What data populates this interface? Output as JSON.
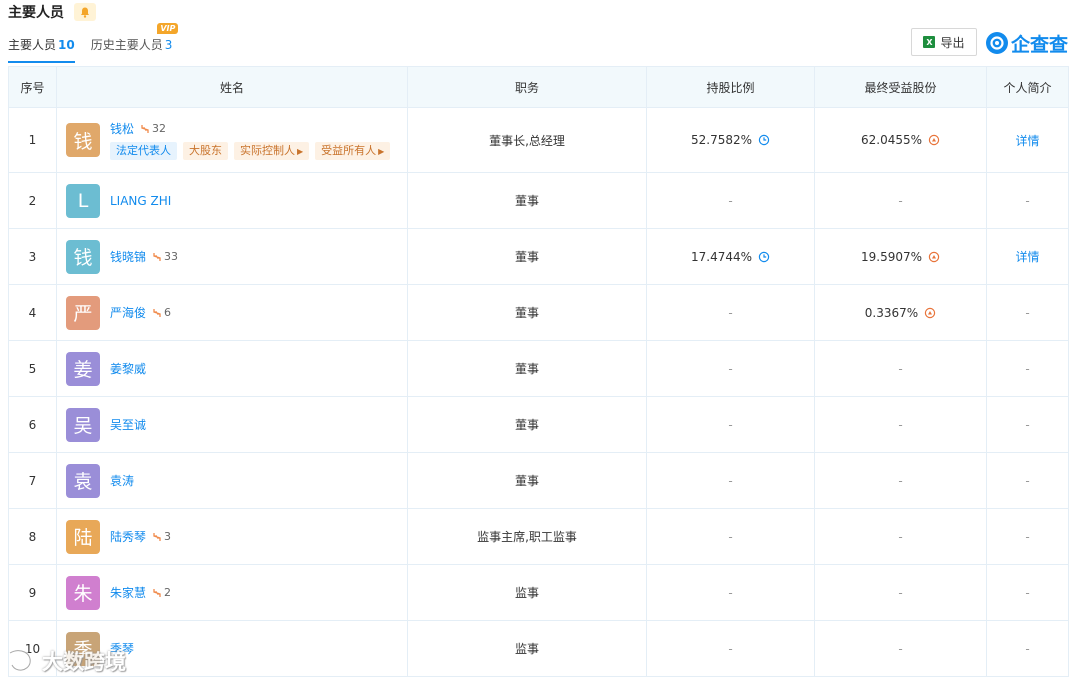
{
  "header": {
    "title": "主要人员"
  },
  "tabs": [
    {
      "label": "主要人员",
      "count": "10"
    },
    {
      "label": "历史主要人员",
      "count": "3",
      "badge": "VIP"
    }
  ],
  "toolbar": {
    "export_label": "导出",
    "excel_glyph": "X",
    "brand": "企查查"
  },
  "columns": [
    "序号",
    "姓名",
    "职务",
    "持股比例",
    "最终受益股份",
    "个人简介"
  ],
  "rows": [
    {
      "no": "1",
      "avatar": "钱",
      "avatar_color": "#e0a86a",
      "name": "钱松",
      "rel": "32",
      "tags": [
        {
          "text": "法定代表人",
          "style": "blue",
          "arrow": false
        },
        {
          "text": "大股东",
          "style": "orange",
          "arrow": false
        },
        {
          "text": "实际控制人",
          "style": "orange",
          "arrow": true
        },
        {
          "text": "受益所有人",
          "style": "orange",
          "arrow": true
        }
      ],
      "position": "董事长,总经理",
      "share": "52.7582%",
      "final": "62.0455%",
      "intro": "详情"
    },
    {
      "no": "2",
      "avatar": "L",
      "avatar_color": "#6cbdd2",
      "name": "LIANG ZHI",
      "rel": "",
      "tags": [],
      "position": "董事",
      "share": "-",
      "final": "-",
      "intro": "-"
    },
    {
      "no": "3",
      "avatar": "钱",
      "avatar_color": "#6cbdd2",
      "name": "钱晓锦",
      "rel": "33",
      "tags": [],
      "position": "董事",
      "share": "17.4744%",
      "final": "19.5907%",
      "intro": "详情"
    },
    {
      "no": "4",
      "avatar": "严",
      "avatar_color": "#e39b7c",
      "name": "严海俊",
      "rel": "6",
      "tags": [],
      "position": "董事",
      "share": "-",
      "final": "0.3367%",
      "intro": "-"
    },
    {
      "no": "5",
      "avatar": "姜",
      "avatar_color": "#9a8ed8",
      "name": "姜黎威",
      "rel": "",
      "tags": [],
      "position": "董事",
      "share": "-",
      "final": "-",
      "intro": "-"
    },
    {
      "no": "6",
      "avatar": "吴",
      "avatar_color": "#9a8ed8",
      "name": "吴至诚",
      "rel": "",
      "tags": [],
      "position": "董事",
      "share": "-",
      "final": "-",
      "intro": "-"
    },
    {
      "no": "7",
      "avatar": "袁",
      "avatar_color": "#9a8ed8",
      "name": "袁涛",
      "rel": "",
      "tags": [],
      "position": "董事",
      "share": "-",
      "final": "-",
      "intro": "-"
    },
    {
      "no": "8",
      "avatar": "陆",
      "avatar_color": "#e8a858",
      "name": "陆秀琴",
      "rel": "3",
      "tags": [],
      "position": "监事主席,职工监事",
      "share": "-",
      "final": "-",
      "intro": "-"
    },
    {
      "no": "9",
      "avatar": "朱",
      "avatar_color": "#d07fcf",
      "name": "朱家慧",
      "rel": "2",
      "tags": [],
      "position": "监事",
      "share": "-",
      "final": "-",
      "intro": "-"
    },
    {
      "no": "10",
      "avatar": "季",
      "avatar_color": "#c8a477",
      "name": "季琴",
      "rel": "",
      "tags": [],
      "position": "监事",
      "share": "-",
      "final": "-",
      "intro": "-"
    }
  ],
  "watermark": {
    "text": "大数跨境"
  },
  "colors": {
    "accent": "#128bed",
    "header_bg": "#f2f9fc",
    "tag_orange": "#c9742d"
  }
}
